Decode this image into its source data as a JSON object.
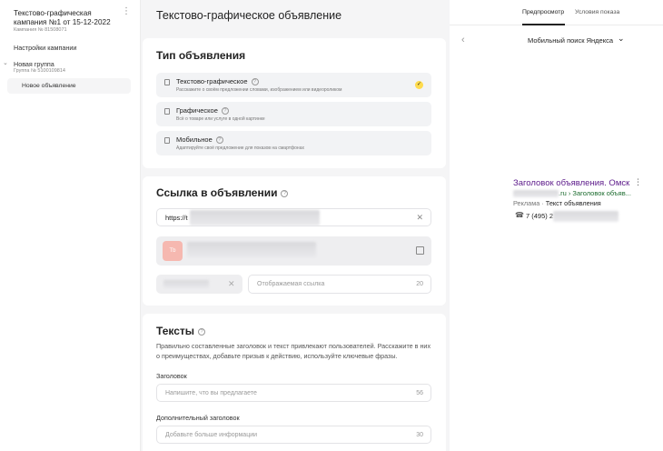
{
  "sidebar": {
    "campaign_title": "Текстово-графическая кампания №1 от 15-12-2022",
    "campaign_sub": "Кампания № 81508071",
    "settings": "Настройки кампании",
    "group_title": "Новая группа",
    "group_sub": "Группа № 5100109814",
    "ad_item": "Новое объявление"
  },
  "page": {
    "title": "Текстово-графическое объявление"
  },
  "ad_type": {
    "title": "Тип объявления",
    "options": [
      {
        "title": "Текстово-графическое",
        "desc": "Расскажите о своём предложении словами, изображением или видеороликом",
        "selected": true
      },
      {
        "title": "Графическое",
        "desc": "Всё о товаре или услуге в одной картинке",
        "selected": false
      },
      {
        "title": "Мобильное",
        "desc": "Адаптируйте своё предложение для показов на смартфонах",
        "selected": false
      }
    ]
  },
  "link": {
    "title": "Ссылка в объявлении",
    "url_value": "https://t",
    "turbo_badge": "Тb",
    "display_link_placeholder": "Отображаемая ссылка",
    "display_link_count": "20"
  },
  "texts": {
    "title": "Тексты",
    "hint": "Правильно составленные заголовок и текст привлекают пользователей. Расскажите в них о преимуществах, добавьте призыв к действию, используйте ключевые фразы.",
    "headline_label": "Заголовок",
    "headline_placeholder": "Напишите, что вы предлагаете",
    "headline_count": "56",
    "subheadline_label": "Дополнительный заголовок",
    "subheadline_placeholder": "Добавьте больше информации",
    "subheadline_count": "30"
  },
  "preview": {
    "tab_preview": "Предпросмотр",
    "tab_conditions": "Условия показа",
    "device": "Мобильный поиск Яндекса",
    "ad_title": "Заголовок объявления. Омск",
    "ad_url_tail": ".ru › Заголовок объяв...",
    "ad_label": "Реклама ·",
    "ad_text": "Текст объявления",
    "phone": "7 (495) 2"
  },
  "colors": {
    "accent": "#ffdb4d",
    "ad_title": "#5c1a8a",
    "ad_url": "#1b6b2e"
  }
}
